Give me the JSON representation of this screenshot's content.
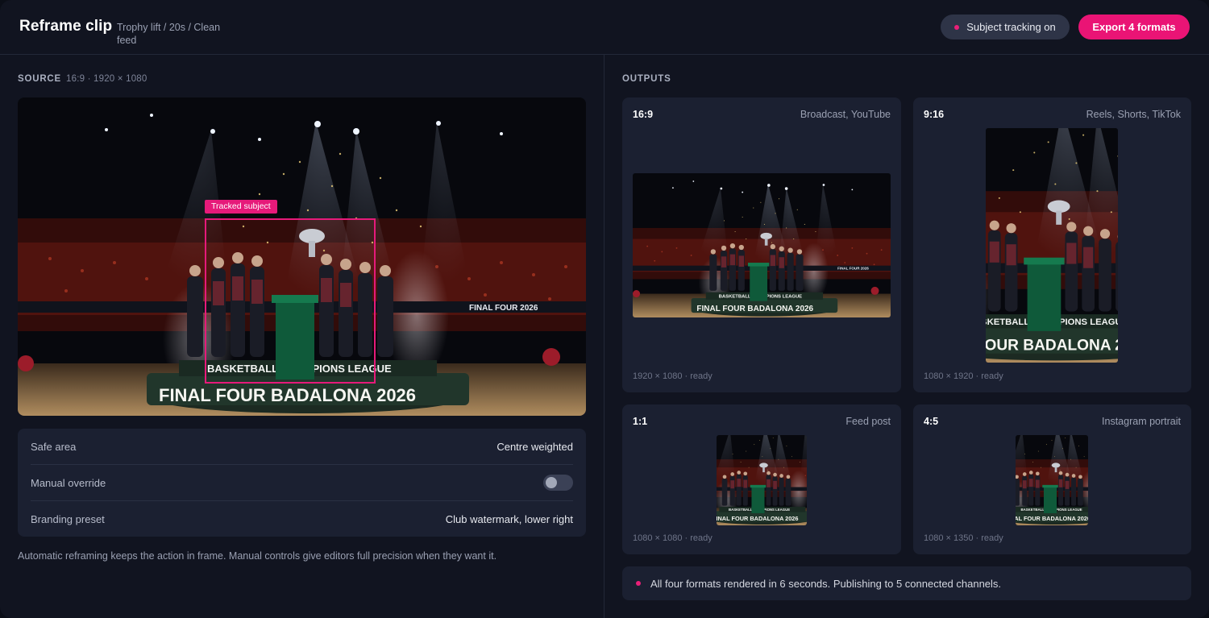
{
  "header": {
    "title": "Reframe clip",
    "subtitle": "Trophy lift / 20s / Clean feed",
    "tracking_label": "Subject tracking on",
    "export_label": "Export 4 formats"
  },
  "source": {
    "label": "SOURCE",
    "meta": "16:9 · 1920 × 1080",
    "tracked_label": "Tracked subject",
    "banner_top": "BASKETBALL CHAMPIONS LEAGUE",
    "banner_main": "FINAL FOUR BADALONA 2026",
    "board_text": "FINAL FOUR 2026"
  },
  "settings": [
    {
      "label": "Safe area",
      "value": "Centre weighted"
    },
    {
      "label": "Manual override",
      "value": "",
      "toggle": false
    },
    {
      "label": "Branding preset",
      "value": "Club watermark, lower right"
    }
  ],
  "caption": "Automatic reframing keeps the action in frame. Manual controls give editors full precision when they want it.",
  "outputs": {
    "label": "OUTPUTS",
    "cards": [
      {
        "ratio": "16:9",
        "use": "Broadcast, YouTube",
        "status": "1920 × 1080 · ready"
      },
      {
        "ratio": "9:16",
        "use": "Reels, Shorts, TikTok",
        "status": "1080 × 1920 · ready"
      },
      {
        "ratio": "1:1",
        "use": "Feed post",
        "status": "1080 × 1080 · ready"
      },
      {
        "ratio": "4:5",
        "use": "Instagram portrait",
        "status": "1080 × 1350 · ready"
      }
    ],
    "summary": "All four formats rendered in 6 seconds. Publishing to 5 connected channels."
  },
  "colors": {
    "accent": "#ea1475",
    "panel": "#1b2031",
    "background": "#111420"
  }
}
